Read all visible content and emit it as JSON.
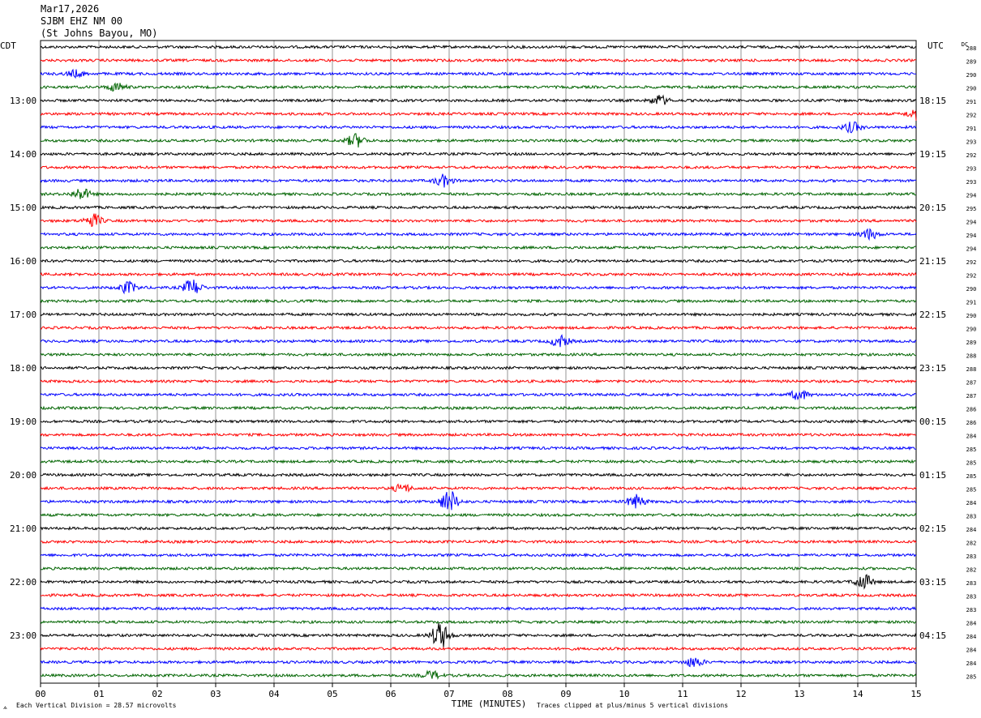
{
  "header": {
    "date": "Mar17,2026",
    "channel": "SJBM EHZ NM 00",
    "location": "(St Johns Bayou, MO)"
  },
  "chart_data": {
    "type": "line",
    "xlabel": "TIME (MINUTES)",
    "xlim": [
      0,
      15
    ],
    "x_ticks": [
      "00",
      "01",
      "02",
      "03",
      "04",
      "05",
      "06",
      "07",
      "08",
      "09",
      "10",
      "11",
      "12",
      "13",
      "14",
      "15"
    ],
    "left_axis_label": "CDT",
    "right_axis_label": "UTC",
    "dc_label": "DC",
    "left_hour_labels": [
      "13:00",
      "14:00",
      "15:00",
      "16:00",
      "17:00",
      "18:00",
      "19:00",
      "20:00",
      "21:00",
      "22:00",
      "23:00"
    ],
    "right_hour_labels": [
      "18:15",
      "19:15",
      "20:15",
      "21:15",
      "22:15",
      "23:15",
      "00:15",
      "01:15",
      "02:15",
      "03:15",
      "04:15"
    ],
    "dc_values": [
      288,
      289,
      290,
      290,
      291,
      292,
      291,
      293,
      292,
      293,
      293,
      294,
      295,
      294,
      294,
      294,
      292,
      292,
      290,
      291,
      290,
      290,
      289,
      288,
      288,
      287,
      287,
      286,
      286,
      284,
      285,
      285,
      285,
      285,
      284,
      283,
      284,
      282,
      283,
      282,
      283,
      283,
      283,
      284,
      284,
      284,
      284,
      285
    ],
    "trace_colors": [
      "#000000",
      "#ff0000",
      "#0000ff",
      "#006400"
    ],
    "footer_left": "Each Vertical Division =   28.57 microvolts",
    "footer_right": "Traces clipped at plus/minus 5 vertical divisions",
    "events": [
      {
        "row": 2,
        "minute": 0.6,
        "amp": 4
      },
      {
        "row": 3,
        "minute": 1.3,
        "amp": 5
      },
      {
        "row": 4,
        "minute": 10.6,
        "amp": 6
      },
      {
        "row": 5,
        "minute": 15.0,
        "amp": 7
      },
      {
        "row": 6,
        "minute": 13.9,
        "amp": 6
      },
      {
        "row": 7,
        "minute": 5.4,
        "amp": 8
      },
      {
        "row": 10,
        "minute": 6.9,
        "amp": 7
      },
      {
        "row": 11,
        "minute": 0.7,
        "amp": 7
      },
      {
        "row": 13,
        "minute": 0.9,
        "amp": 8
      },
      {
        "row": 14,
        "minute": 14.2,
        "amp": 6
      },
      {
        "row": 18,
        "minute": 1.5,
        "amp": 7
      },
      {
        "row": 18,
        "minute": 2.6,
        "amp": 10
      },
      {
        "row": 22,
        "minute": 8.9,
        "amp": 7
      },
      {
        "row": 26,
        "minute": 13.0,
        "amp": 6
      },
      {
        "row": 33,
        "minute": 6.2,
        "amp": 5
      },
      {
        "row": 34,
        "minute": 7.0,
        "amp": 14
      },
      {
        "row": 34,
        "minute": 10.2,
        "amp": 8
      },
      {
        "row": 40,
        "minute": 14.1,
        "amp": 9
      },
      {
        "row": 44,
        "minute": 6.85,
        "amp": 16
      },
      {
        "row": 46,
        "minute": 11.2,
        "amp": 6
      },
      {
        "row": 47,
        "minute": 6.7,
        "amp": 5
      }
    ]
  }
}
